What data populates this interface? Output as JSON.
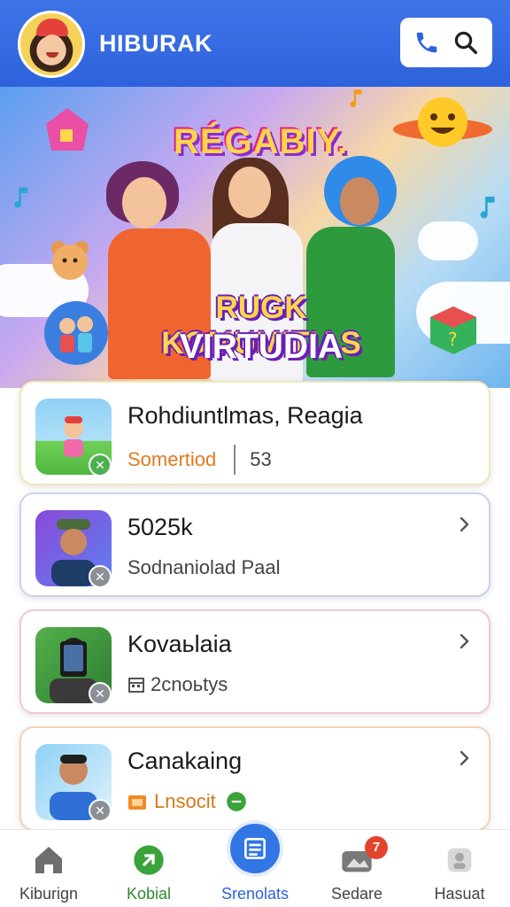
{
  "header": {
    "title": "HIBURAK",
    "colors": {
      "background": "#2d62dc",
      "phone_icon": "#2d62dc"
    },
    "icons": {
      "phone": "phone-icon",
      "search": "search-icon"
    }
  },
  "banner": {
    "title": "RÉGABIY.",
    "subtitle_line1": "RUGK KOMUMITIAS",
    "subtitle_line2": "VIRTUDIA"
  },
  "cards": [
    {
      "title": "Rohdiuntlmas, Reagia",
      "sub_primary": "Somertiod",
      "sub_secondary": "53",
      "sub_icon": "",
      "has_chevron": false,
      "badge": "check"
    },
    {
      "title": "5025k",
      "sub_primary": "Sodnaniolad Paal",
      "sub_secondary": "",
      "sub_icon": "",
      "has_chevron": true,
      "badge": "close"
    },
    {
      "title": "Kovaьlaia",
      "sub_primary": "2cnoьtys",
      "sub_secondary": "",
      "sub_icon": "calendar-icon",
      "has_chevron": true,
      "badge": "close"
    },
    {
      "title": "Canakaing",
      "sub_primary": "Lnsocit",
      "sub_secondary": "",
      "sub_icon": "folder-icon",
      "has_chevron": true,
      "badge": "close"
    }
  ],
  "nav": {
    "items": [
      {
        "label": "Kiburign",
        "icon": "home-icon"
      },
      {
        "label": "Kobial",
        "icon": "chat-icon"
      },
      {
        "label": "Srenolats",
        "icon": "list-icon"
      },
      {
        "label": "Sedare",
        "icon": "cloud-icon",
        "badge": "7"
      },
      {
        "label": "Hasuat",
        "icon": "profile-icon"
      }
    ],
    "active_index": 2,
    "colors": {
      "active": "#2d62dc",
      "green": "#3aa33a",
      "badge": "#e5432d"
    }
  }
}
